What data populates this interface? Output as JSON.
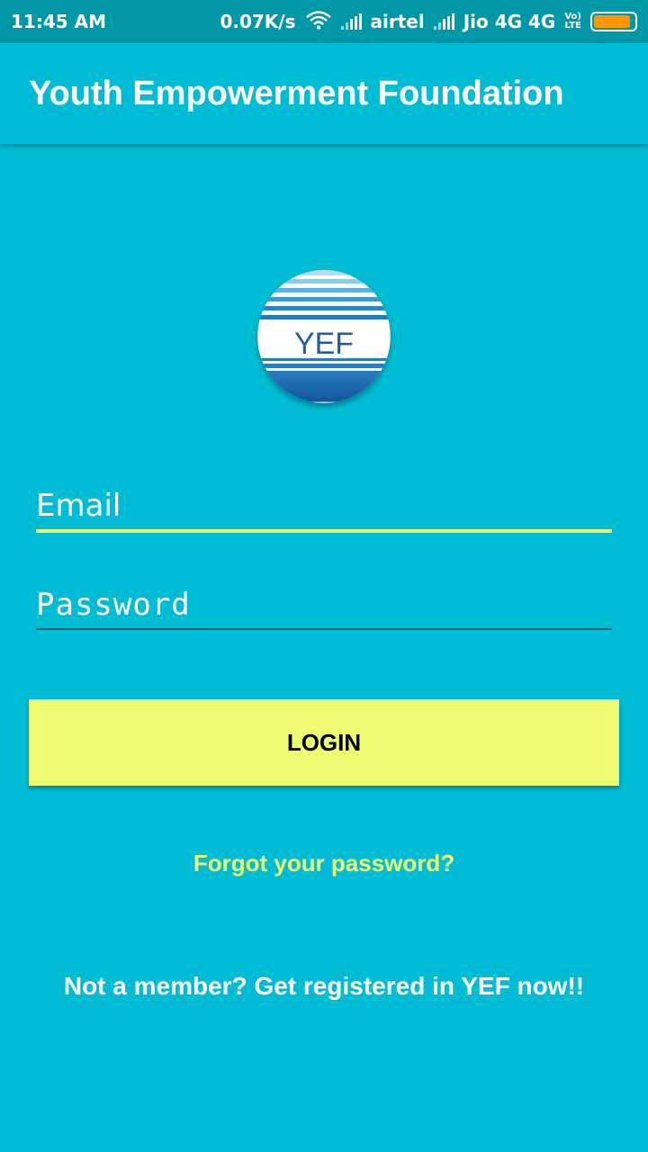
{
  "status_bar": {
    "time": "11:45 AM",
    "network_speed": "0.07K/s",
    "icons": [
      "wifi-icon",
      "signal-icon",
      "signal-icon",
      "volte-icon",
      "battery-icon"
    ],
    "carrier1": "airtel",
    "carrier2": "Jio 4G 4G",
    "volte_top": "Vo)",
    "volte_bottom": "LTE",
    "battery_color": "#FF9800"
  },
  "app_bar": {
    "title": "Youth Empowerment Foundation"
  },
  "logo": {
    "text": "YEF"
  },
  "form": {
    "email_placeholder": "Email",
    "password_placeholder": "Password",
    "login_label": "LOGIN",
    "forgot_label": "Forgot your password?",
    "register_label": "Not a member? Get registered in YEF now!!"
  },
  "colors": {
    "background": "#00BCD4",
    "status_bar": "#0097A7",
    "accent": "#EEFC72",
    "text": "#FFFFFF"
  }
}
